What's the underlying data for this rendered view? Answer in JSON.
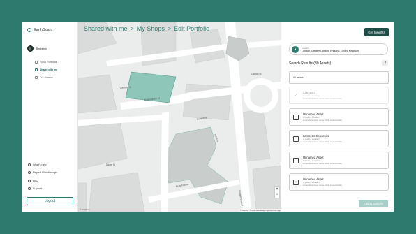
{
  "app": {
    "name": "EarthScan"
  },
  "user": {
    "initial": "B",
    "name": "Benjamin"
  },
  "nav": [
    {
      "label": "Public Portfolios",
      "active": false
    },
    {
      "label": "Shared with me",
      "active": true
    },
    {
      "label": "Our Science",
      "active": false
    }
  ],
  "footer_nav": [
    {
      "label": "What's new",
      "icon": "info-icon"
    },
    {
      "label": "Repeat Walkthrough",
      "icon": "replay-icon"
    },
    {
      "label": "FAQ",
      "icon": "faq-icon"
    },
    {
      "label": "Support",
      "icon": "support-icon"
    }
  ],
  "logout_label": "Logout",
  "breadcrumb": [
    "Shared with me",
    ">",
    "My Shops",
    ">",
    "Edit Portfolio"
  ],
  "map": {
    "streets": [
      "Carteret St",
      "Broadway",
      "Buckingham St",
      "Caxton St",
      "Petty France",
      "Tothill St",
      "Dacre St",
      "Strutton Ground"
    ],
    "zoom_in": "+",
    "zoom_out": "−",
    "attribution": "© Mapbox © OpenStreetMap Improve this map",
    "logo": "© mapbox"
  },
  "panel": {
    "insights_button": "Get Insights",
    "location_label": "Location",
    "location_value": "London, Greater London, England, United Kingdom",
    "results_title": "Search Results (30 Assets)",
    "all_assets": "All assets",
    "assets": [
      {
        "name": "Clarkes J",
        "sub1": "In status - Location",
        "sub2": "somewhere street name which is placeholder",
        "checked": true
      },
      {
        "name": "Unnamed Asset",
        "sub1": "In status - Location",
        "sub2": "somewhere street name which is placeholder",
        "checked": false
      },
      {
        "name": "Lamberts Souvenirs",
        "sub1": "In status - Location",
        "sub2": "somewhere street name which is placeholder",
        "checked": false
      },
      {
        "name": "Unnamed Asset",
        "sub1": "In status - Location",
        "sub2": "somewhere street name which is placeholder",
        "checked": false
      },
      {
        "name": "Unnamed Asset",
        "sub1": "In status - Location",
        "sub2": "somewhere street name which is placeholder",
        "checked": false
      }
    ],
    "add_button": "Add to portfolio"
  },
  "colors": {
    "background": "#2f7a6e",
    "accent": "#2f7a6e",
    "dark_button": "#1f4e47",
    "selected_building": "#8fc6ba"
  }
}
